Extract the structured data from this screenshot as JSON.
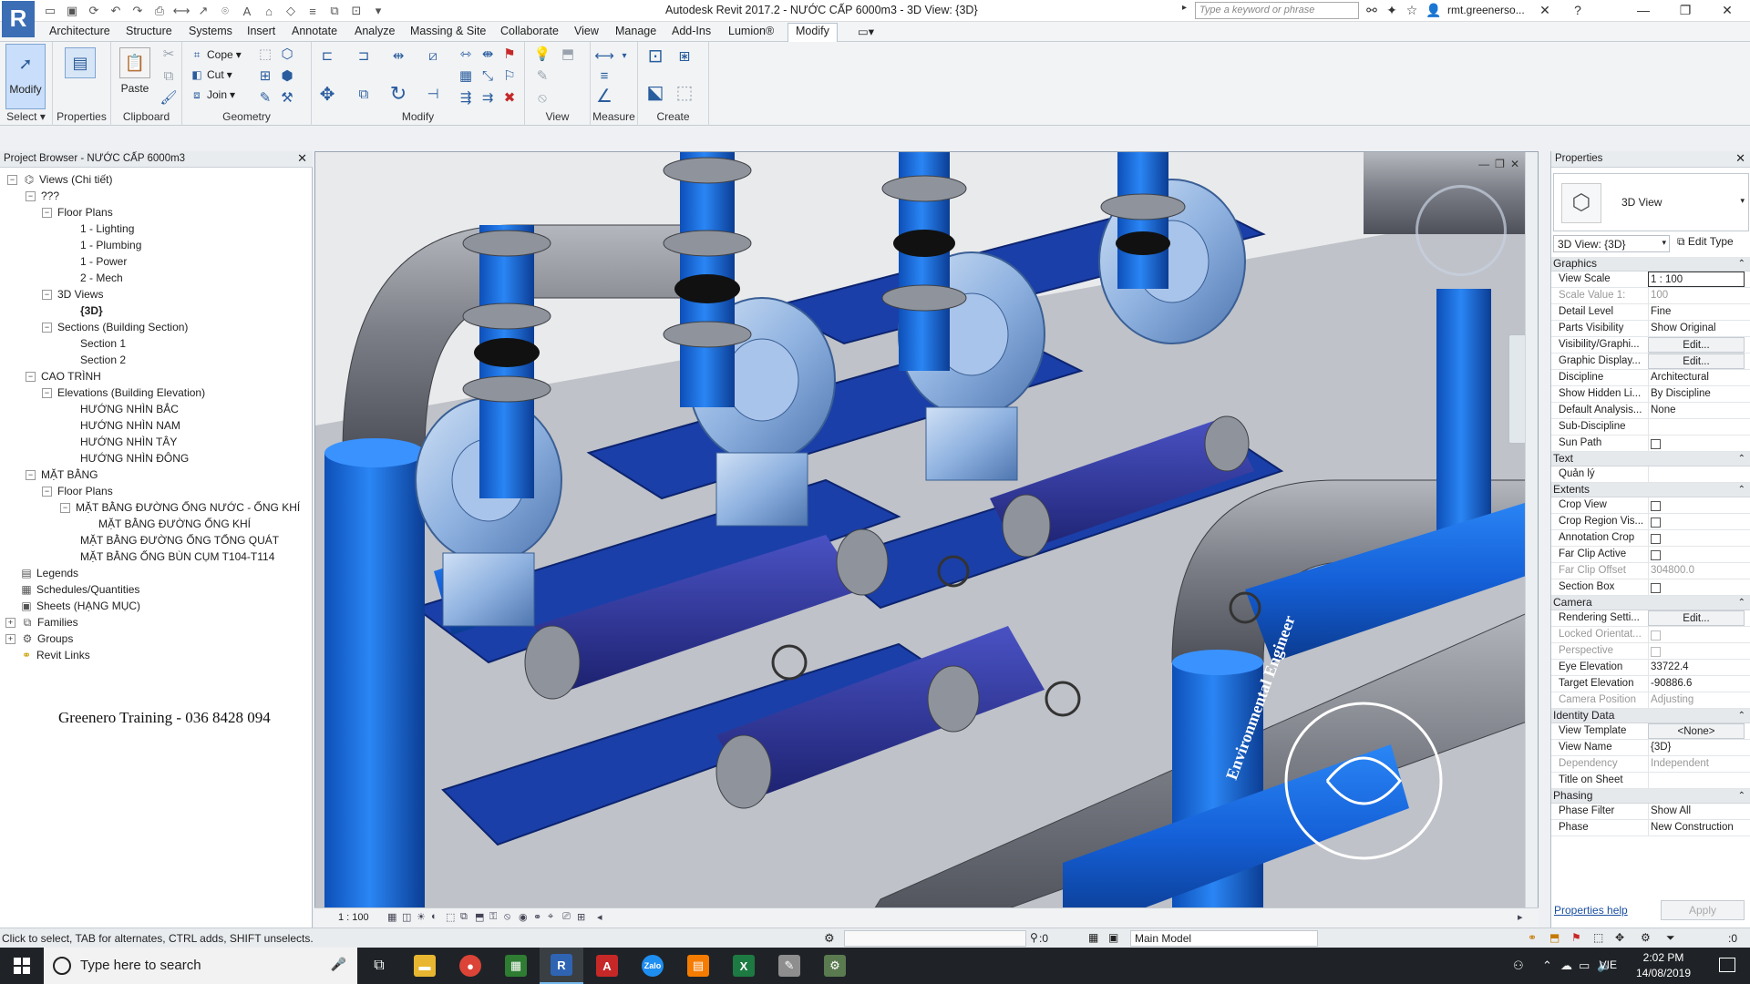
{
  "app": {
    "title": "Autodesk Revit 2017.2 -   NƯỚC CẤP 6000m3 - 3D View: {3D}",
    "search_placeholder": "Type a keyword or phrase",
    "user": "rmt.greenerso..."
  },
  "ribbon_tabs": [
    "Architecture",
    "Structure",
    "Systems",
    "Insert",
    "Annotate",
    "Analyze",
    "Massing & Site",
    "Collaborate",
    "View",
    "Manage",
    "Add-Ins",
    "Lumion®",
    "Modify"
  ],
  "ribbon": {
    "modify_label": "Modify",
    "properties_label": "Properties",
    "paste_label": "Paste",
    "cope_label": "Cope",
    "cut_label": "Cut",
    "join_label": "Join",
    "panels": {
      "select": "Select",
      "properties": "Properties",
      "clipboard": "Clipboard",
      "geometry": "Geometry",
      "modify": "Modify",
      "view": "View",
      "measure": "Measure",
      "create": "Create"
    }
  },
  "project_browser": {
    "title": "Project Browser - NƯỚC CẤP 6000m3",
    "tree": [
      "Views (Chi tiết)",
      "???",
      "Floor Plans",
      "1 - Lighting",
      "1 - Plumbing",
      "1 - Power",
      "2 - Mech",
      "3D Views",
      "{3D}",
      "Sections (Building Section)",
      "Section 1",
      "Section 2",
      "CAO TRÌNH",
      "Elevations (Building Elevation)",
      "HƯỚNG NHÌN BẮC",
      "HƯỚNG NHÌN NAM",
      "HƯỚNG NHÌN TÂY",
      "HƯỚNG NHÌN ĐÔNG",
      "MẶT BẰNG",
      "Floor Plans",
      "MẶT BẰNG ĐƯỜNG ỐNG NƯỚC - ỐNG KHÍ",
      "MẶT BẰNG ĐƯỜNG ỐNG KHÍ",
      "MẶT BẰNG ĐƯỜNG ỐNG TỔNG QUÁT",
      "MẶT BẰNG ỐNG BÙN CỤM T104-T114",
      "Legends",
      "Schedules/Quantities",
      "Sheets (HẠNG MỤC)",
      "Families",
      "Groups",
      "Revit Links"
    ],
    "watermark": "Greenero Training - 036 8428 094"
  },
  "viewport": {
    "scale": "1 : 100",
    "brand_text": "Environmental Engineer",
    "colors": {
      "pipe_blue": "#1e6fe0",
      "pipe_gray": "#7d8088",
      "pump_dark": "#2b2f8c",
      "flange": "#8e939c"
    }
  },
  "properties": {
    "title": "Properties",
    "type_name": "3D View",
    "instance_selector": "3D View: {3D}",
    "edit_type": "Edit Type",
    "sections": {
      "graphics": "Graphics",
      "text": "Text",
      "extents": "Extents",
      "camera": "Camera",
      "identity": "Identity Data",
      "phasing": "Phasing"
    },
    "rows": {
      "view_scale": [
        "View Scale",
        "1 : 100"
      ],
      "scale_value": [
        "Scale Value    1:",
        "100"
      ],
      "detail_level": [
        "Detail Level",
        "Fine"
      ],
      "parts_visibility": [
        "Parts Visibility",
        "Show Original"
      ],
      "visibility": [
        "Visibility/Graphi...",
        "Edit..."
      ],
      "graphic_display": [
        "Graphic Display...",
        "Edit..."
      ],
      "discipline": [
        "Discipline",
        "Architectural"
      ],
      "show_hidden": [
        "Show Hidden Li...",
        "By Discipline"
      ],
      "default_analysis": [
        "Default Analysis...",
        "None"
      ],
      "sub_discipline": [
        "Sub-Discipline",
        ""
      ],
      "sun_path": [
        "Sun Path",
        ""
      ],
      "quan_ly": [
        "Quản lý",
        ""
      ],
      "crop_view": [
        "Crop View",
        ""
      ],
      "crop_region": [
        "Crop Region Vis...",
        ""
      ],
      "annotation_crop": [
        "Annotation Crop",
        ""
      ],
      "far_clip_active": [
        "Far Clip Active",
        ""
      ],
      "far_clip_offset": [
        "Far Clip Offset",
        "304800.0"
      ],
      "section_box": [
        "Section Box",
        ""
      ],
      "rendering": [
        "Rendering Setti...",
        "Edit..."
      ],
      "locked_orient": [
        "Locked Orientat...",
        ""
      ],
      "perspective": [
        "Perspective",
        ""
      ],
      "eye_elevation": [
        "Eye Elevation",
        "33722.4"
      ],
      "target_elevation": [
        "Target Elevation",
        "-90886.6"
      ],
      "camera_position": [
        "Camera Position",
        "Adjusting"
      ],
      "view_template": [
        "View Template",
        "<None>"
      ],
      "view_name": [
        "View Name",
        "{3D}"
      ],
      "dependency": [
        "Dependency",
        "Independent"
      ],
      "title_on_sheet": [
        "Title on Sheet",
        ""
      ],
      "phase_filter": [
        "Phase Filter",
        "Show All"
      ],
      "phase": [
        "Phase",
        "New Construction"
      ]
    },
    "help": "Properties help",
    "apply": "Apply"
  },
  "status": {
    "text": "Click to select, TAB for alternates, CTRL adds, SHIFT unselects.",
    "selection_count": ":0",
    "model": "Main Model",
    "filter_count": ":0"
  },
  "taskbar": {
    "search": "Type here to search",
    "lang": "VIE",
    "time": "2:02 PM",
    "date": "14/08/2019"
  }
}
